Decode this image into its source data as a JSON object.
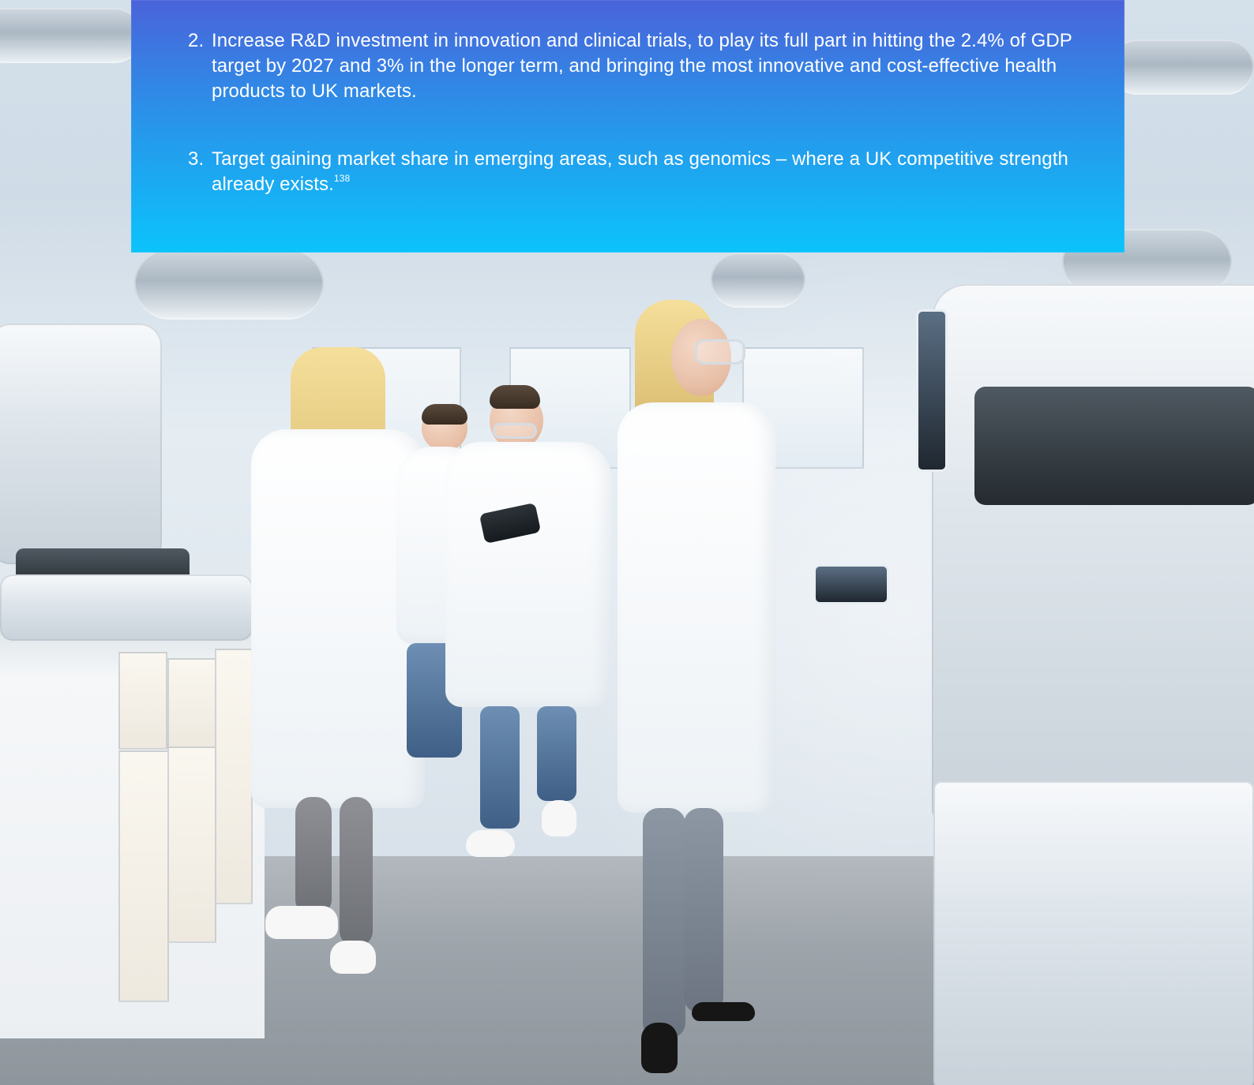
{
  "text_panel": {
    "items": [
      {
        "number": "2.",
        "text": "Increase R&D investment in innovation and clinical trials, to play its full part in hitting the 2.4% of GDP target by 2027 and 3% in the longer term, and bringing the most innovative and cost-effective health products to UK markets."
      },
      {
        "number": "3.",
        "text": "Target gaining market share in emerging areas, such as genomics – where a UK competitive strength already exists.",
        "footnote": "138"
      }
    ]
  }
}
